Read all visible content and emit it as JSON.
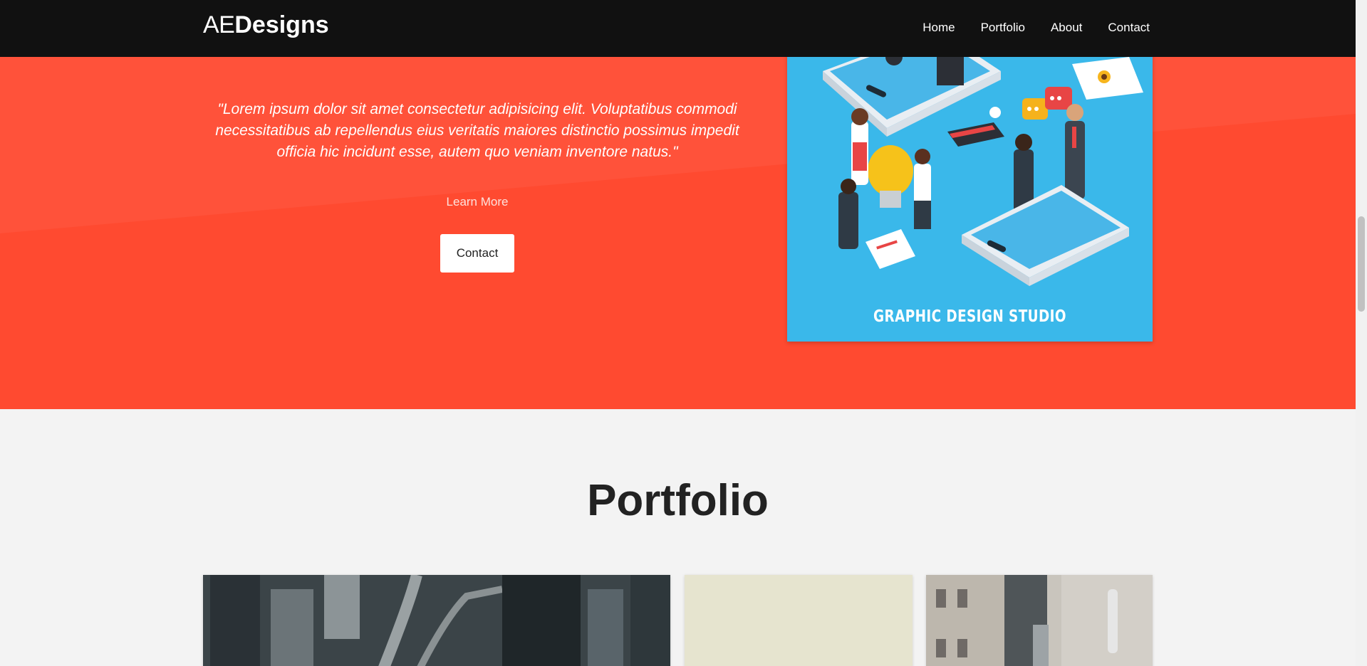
{
  "brand": {
    "light": "AE",
    "bold": "Designs"
  },
  "nav": {
    "items": [
      {
        "label": "Home"
      },
      {
        "label": "Portfolio"
      },
      {
        "label": "About"
      },
      {
        "label": "Contact"
      }
    ]
  },
  "hero": {
    "quote": "\"Lorem ipsum dolor sit amet consectetur adipisicing elit. Voluptatibus commodi necessitatibus ab repellendus eius veritatis maiores distinctio possimus impedit officia hic incidunt esse, autem quo veniam inventore natus.\"",
    "learn_more": "Learn More",
    "contact_button": "Contact",
    "illustration_caption": "GRAPHIC DESIGN STUDIO",
    "background_color": "#ff4a30"
  },
  "portfolio": {
    "title": "Portfolio"
  },
  "colors": {
    "navbar": "#111111",
    "accent": "#ff4a30",
    "page_background": "#f3f3f3"
  }
}
